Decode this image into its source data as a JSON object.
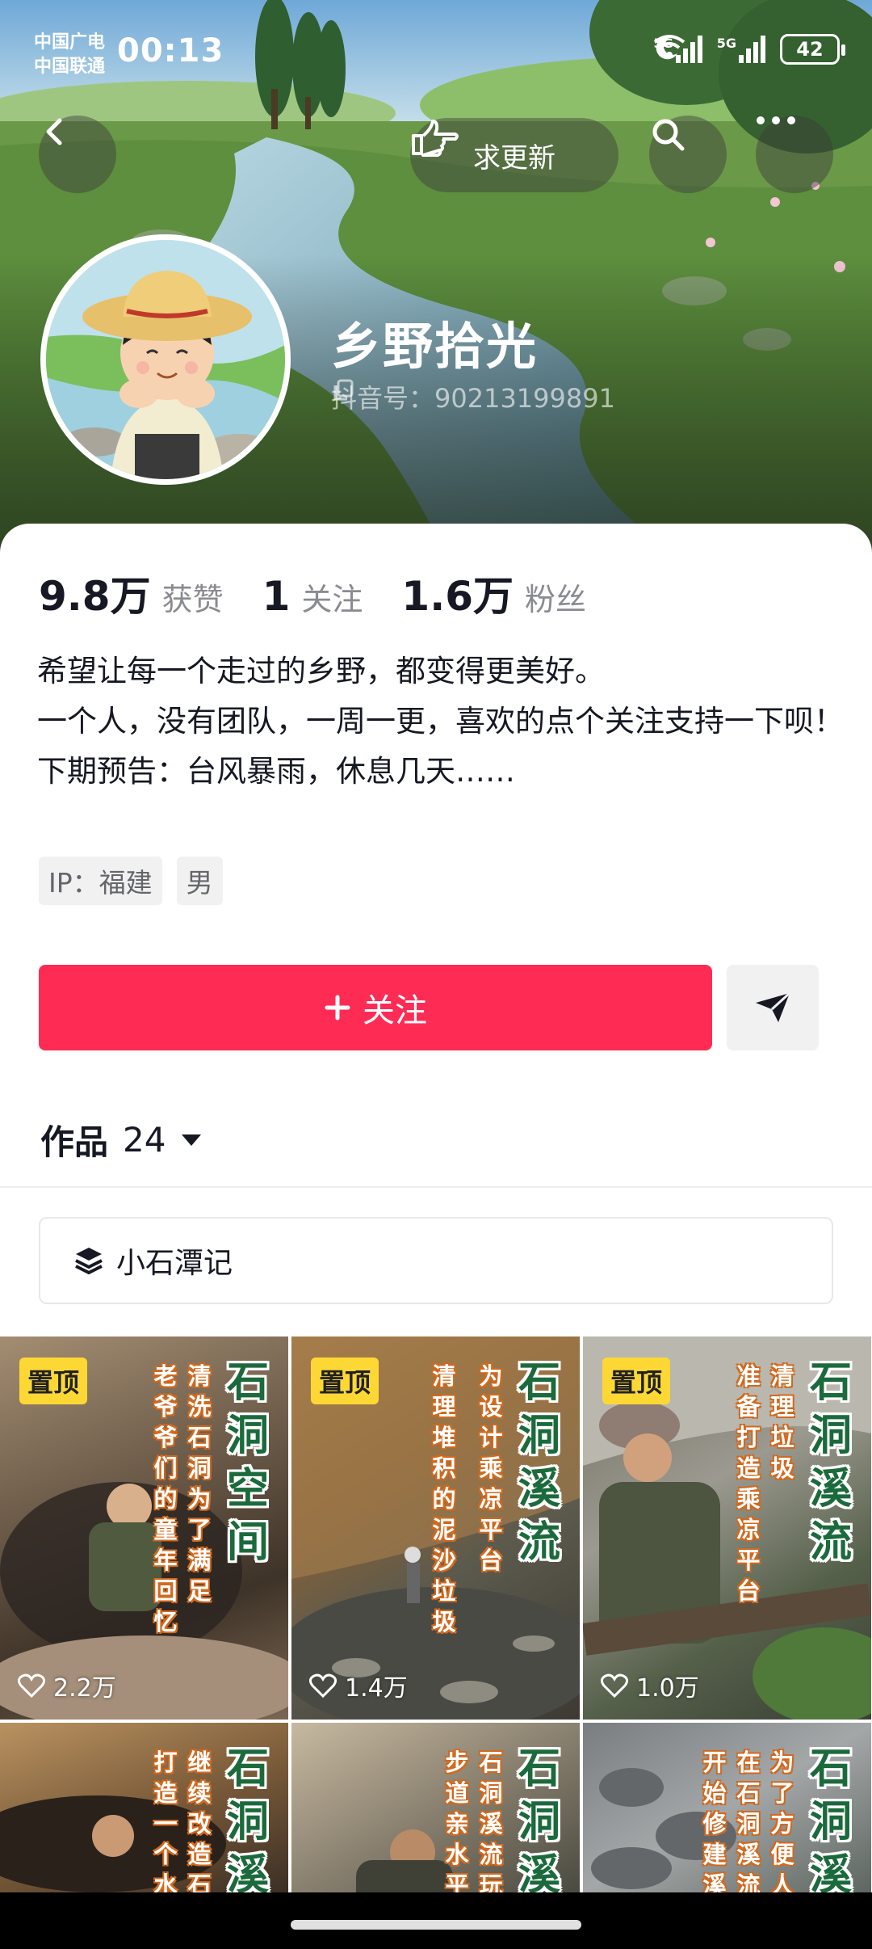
{
  "status_bar": {
    "carrier_1": "中国广电",
    "carrier_2": "中国联通",
    "time": "00:13",
    "battery": "42",
    "signal_1": "5G",
    "signal_2": "5G"
  },
  "header": {
    "request_update_label": "求更新",
    "nickname": "乡野拾光",
    "douyin_id": "抖音号：90213199891"
  },
  "stats": [
    {
      "value": "9.8万",
      "label": "获赞"
    },
    {
      "value": "1",
      "label": "关注"
    },
    {
      "value": "1.6万",
      "label": "粉丝"
    }
  ],
  "bio": {
    "line1": "希望让每一个走过的乡野，都变得更美好。",
    "line2": "一个人，没有团队，一周一更，喜欢的点个关注支持一下呗！",
    "line3": "下期预告：台风暴雨，休息几天……"
  },
  "tags": {
    "ip": "IP：福建",
    "gender": "男"
  },
  "actions": {
    "follow_label": "关注"
  },
  "works": {
    "label": "作品",
    "count": "24"
  },
  "collection": {
    "label": "小石潭记"
  },
  "videos": [
    {
      "pinned": "置顶",
      "likes": "2.2万",
      "title": "石洞空间",
      "sub1": "清洗石洞 为了满足",
      "sub2": "老爷爷们的童年回忆"
    },
    {
      "pinned": "置顶",
      "likes": "1.4万",
      "title": "石洞溪流",
      "sub1": "为设计乘凉平台",
      "sub2": "清理堆积的泥沙垃圾"
    },
    {
      "pinned": "置顶",
      "likes": "1.0万",
      "title": "石洞溪流",
      "sub1": "清理垃圾",
      "sub2": "准备打造乘凉平台"
    },
    {
      "title": "石洞溪",
      "sub1": "继续改造石",
      "sub2": "打造一个水"
    },
    {
      "title": "石洞溪",
      "sub1": "石洞溪流玩",
      "sub2": "步道亲水平台"
    },
    {
      "title": "石洞溪",
      "sub1": "为了方便人们",
      "sub2": "在石洞溪流玩",
      "sub3": "开始修建溪边"
    }
  ]
}
